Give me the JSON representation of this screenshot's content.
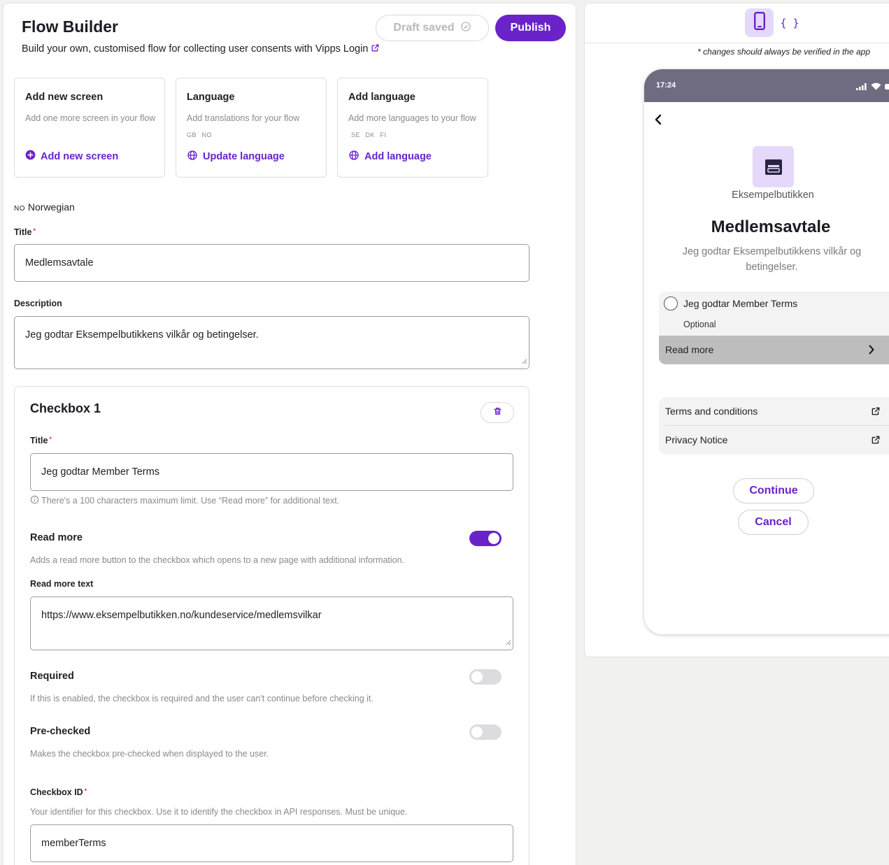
{
  "header": {
    "title": "Flow Builder",
    "subtitle": "Build your own, customised flow for collecting user consents with Vipps Login",
    "draft_label": "Draft saved",
    "publish_label": "Publish"
  },
  "cards": [
    {
      "title": "Add new screen",
      "description": "Add one more screen in your flow",
      "flags": [],
      "action": "Add new screen",
      "action_icon": "plus-circle-icon"
    },
    {
      "title": "Language",
      "description": "Add translations for your flow",
      "flags": [
        "GB",
        "NO"
      ],
      "action": "Update language",
      "action_icon": "globe-icon"
    },
    {
      "title": "Add language",
      "description": "Add more languages to your flow",
      "flags": [
        "SE",
        "DK",
        "FI"
      ],
      "action": "Add language",
      "action_icon": "globe-icon"
    }
  ],
  "language": {
    "code": "NO",
    "name": "Norwegian"
  },
  "form": {
    "title_label": "Title",
    "title_value": "Medlemsavtale",
    "description_label": "Description",
    "description_value": "Jeg godtar Eksempelbutikkens vilkår og betingelser."
  },
  "checkbox": {
    "heading": "Checkbox 1",
    "title_label": "Title",
    "title_value": "Jeg godtar Member Terms",
    "char_hint": "There's a 100 characters maximum limit. Use “Read more” for additional text.",
    "read_more": {
      "label": "Read more",
      "hint": "Adds a read more button to the checkbox which opens to a new page with additional information.",
      "enabled": true
    },
    "read_more_text_label": "Read more text",
    "read_more_text_value": "https://www.eksempelbutikken.no/kundeservice/medlemsvilkar",
    "required": {
      "label": "Required",
      "hint": "If this is enabled, the checkbox is required and the user can't continue before checking it.",
      "enabled": false
    },
    "prechecked": {
      "label": "Pre-checked",
      "hint": "Makes the checkbox pre-checked when displayed to the user.",
      "enabled": false
    },
    "id_label": "Checkbox ID",
    "id_hint": "Your identifier for this checkbox. Use it to identify the checkbox in API responses. Must be unique.",
    "id_value": "memberTerms"
  },
  "preview": {
    "note": "* changes should always be verified in the app",
    "view_icons": [
      "phone-icon",
      "code-braces-icon"
    ],
    "code_glyph": "{ }",
    "phone": {
      "time": "17:24",
      "merchant": "Eksempelbutikken",
      "title": "Medlemsavtale",
      "description": "Jeg godtar Eksempelbutikkens vilkår og betingelser.",
      "consent_label": "Jeg godtar Member Terms",
      "optional_label": "Optional",
      "read_more_label": "Read more",
      "links": [
        "Terms and conditions",
        "Privacy Notice"
      ],
      "continue_label": "Continue",
      "cancel_label": "Cancel"
    }
  },
  "colors": {
    "accent": "#6a23c9",
    "accent_light": "#e5d9fb",
    "status_bar": "#6f6c81"
  }
}
